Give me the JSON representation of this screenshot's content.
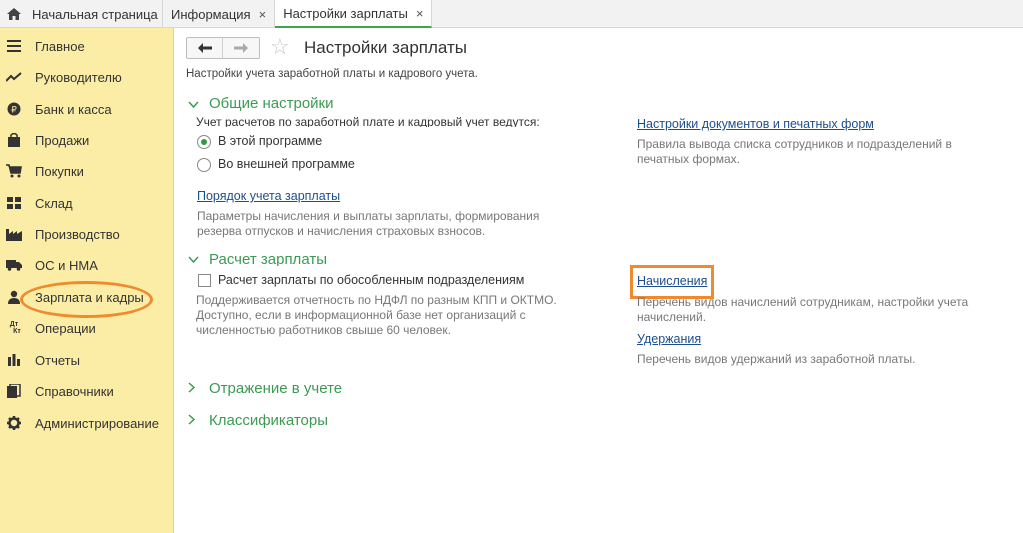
{
  "tabs": [
    {
      "label": "Начальная страница",
      "icon": "home-icon"
    },
    {
      "label": "Информация",
      "close": "×"
    },
    {
      "label": "Настройки зарплаты",
      "close": "×",
      "active": true
    }
  ],
  "sidebar": {
    "items": [
      {
        "label": "Главное",
        "icon": "menu-icon"
      },
      {
        "label": "Руководителю",
        "icon": "trend-icon"
      },
      {
        "label": "Банк и касса",
        "icon": "coin-icon"
      },
      {
        "label": "Продажи",
        "icon": "shopping-bag-icon"
      },
      {
        "label": "Покупки",
        "icon": "cart-icon"
      },
      {
        "label": "Склад",
        "icon": "warehouse-icon"
      },
      {
        "label": "Производство",
        "icon": "factory-icon"
      },
      {
        "label": "ОС и НМА",
        "icon": "truck-icon"
      },
      {
        "label": "Зарплата и кадры",
        "icon": "person-icon"
      },
      {
        "label": "Операции",
        "icon": "dt-kt-icon"
      },
      {
        "label": "Отчеты",
        "icon": "bar-chart-icon"
      },
      {
        "label": "Справочники",
        "icon": "book-icon"
      },
      {
        "label": "Администрирование",
        "icon": "gear-icon"
      }
    ],
    "dt_kt": {
      "dt": "Дт",
      "kt": "Кт"
    }
  },
  "page": {
    "title": "Настройки зарплаты",
    "subtitle": "Настройки учета заработной платы и кадрового учета."
  },
  "general": {
    "header": "Общие настройки",
    "accounting_question": "Учет расчетов по заработной плате и кадровый учет ведутся:",
    "option_in_program": "В этой программе",
    "option_external": "Во внешней программе",
    "order_link": "Порядок учета зарплаты",
    "order_hint_1": "Параметры начисления и выплаты зарплаты, формирования",
    "order_hint_2": "резерва отпусков и начисления страховых взносов.",
    "docs_link": "Настройки документов и печатных форм",
    "docs_hint_1": "Правила вывода списка сотрудников и подразделений в",
    "docs_hint_2": "печатных формах."
  },
  "calc": {
    "header": "Расчет зарплаты",
    "checkbox_label": "Расчет зарплаты по обособленным подразделениям",
    "checkbox_hint_1": "Поддерживается отчетность по НДФЛ по разным КПП и ОКТМО.",
    "checkbox_hint_2": "Доступно, если в информационной базе нет организаций с",
    "checkbox_hint_3": "численностью работников свыше 60 человек.",
    "accruals_link": "Начисления",
    "accruals_hint_1": "Перечень видов начислений сотрудникам, настройки учета",
    "accruals_hint_2": "начислений.",
    "deductions_link": "Удержания",
    "deductions_hint": "Перечень видов удержаний из заработной платы."
  },
  "collapsed_sections": [
    "Отражение в учете",
    "Классификаторы"
  ],
  "colors": {
    "sidebar_bg": "#fbeda6",
    "accent_green": "#3c9a55",
    "highlight_orange": "#f08a2e",
    "link_blue": "#1d4e8f"
  }
}
